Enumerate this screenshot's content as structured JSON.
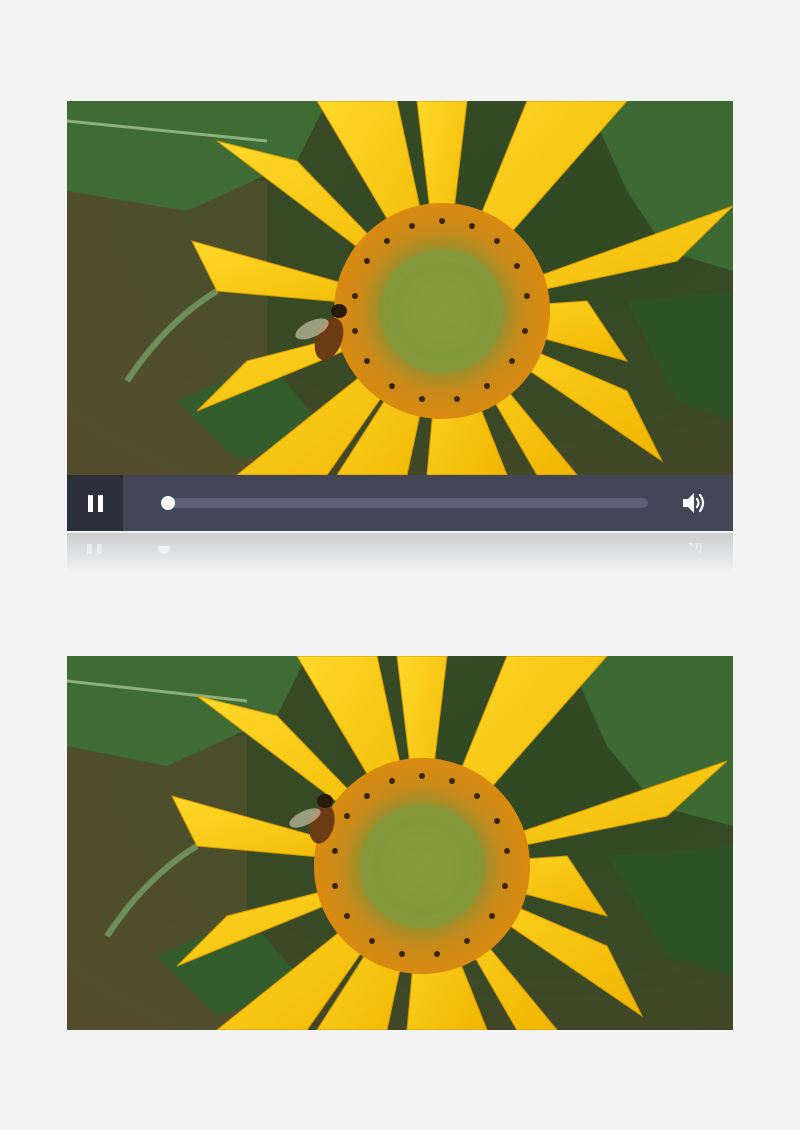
{
  "player": {
    "state": "playing",
    "progress_fraction": 0.0,
    "pause_icon": "pause-icon",
    "volume_icon": "volume-icon",
    "colors": {
      "bar": "#424656",
      "button": "#2c2f3c",
      "track": "#5c6072",
      "knob": "#ffffff",
      "page": "#f3f3f3"
    }
  },
  "frames": [
    {
      "subject": "sunflower-with-bee"
    },
    {
      "subject": "sunflower-with-bee"
    }
  ]
}
